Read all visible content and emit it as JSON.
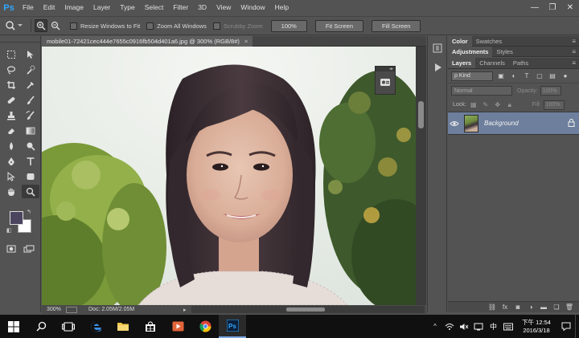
{
  "app": {
    "logo": "Ps"
  },
  "menu": [
    "File",
    "Edit",
    "Image",
    "Layer",
    "Type",
    "Select",
    "Filter",
    "3D",
    "View",
    "Window",
    "Help"
  ],
  "window_controls": {
    "minimize": "—",
    "restore": "❐",
    "close": "✕"
  },
  "options_bar": {
    "tool_icon": "zoom-icon",
    "checkboxes": [
      {
        "label": "Resize Windows to Fit",
        "checked": false,
        "enabled": true
      },
      {
        "label": "Zoom All Windows",
        "checked": false,
        "enabled": true
      },
      {
        "label": "Scrubby Zoom",
        "checked": false,
        "enabled": false
      }
    ],
    "buttons": [
      "100%",
      "Fit Screen",
      "Fill Screen"
    ]
  },
  "document": {
    "tab_title": "mobile01-72421cec444e7655c0916fb504d401a6.jpg @ 300% (RGB/8#)",
    "close": "×"
  },
  "status": {
    "zoom": "300%",
    "doc": "Doc: 2.05M/2.05M",
    "arrow": "▸"
  },
  "toolbar": {
    "tools": [
      "marquee-tool",
      "move-tool",
      "lasso-tool",
      "quick-selection-tool",
      "crop-tool",
      "eyedropper-tool",
      "healing-brush-tool",
      "brush-tool",
      "clone-stamp-tool",
      "history-brush-tool",
      "eraser-tool",
      "gradient-tool",
      "blur-tool",
      "dodge-tool",
      "pen-tool",
      "type-tool",
      "path-selection-tool",
      "shape-tool",
      "hand-tool",
      "zoom-tool"
    ],
    "active_tool": "zoom-tool",
    "foreground_color": "#4b4560",
    "background_color": "#ffffff"
  },
  "panels": {
    "color_tabs": [
      "Color",
      "Swatches"
    ],
    "adjust_tabs": [
      "Adjustments",
      "Styles"
    ],
    "layers_tabs": [
      "Layers",
      "Channels",
      "Paths"
    ],
    "kind_label": "ρ Kind",
    "blend_mode": "Normal",
    "opacity_label": "Opacity:",
    "opacity_value": "100%",
    "lock_label": "Lock:",
    "fill_label": "Fill:",
    "fill_value": "100%",
    "layer": {
      "name": "Background"
    }
  },
  "taskbar": {
    "apps": [
      "windows-start",
      "search",
      "task-view",
      "edge",
      "file-explorer",
      "store",
      "media-player",
      "chrome",
      "photoshop"
    ],
    "ime": "中",
    "time": "下午 12:54",
    "date": "2016/3/18"
  }
}
